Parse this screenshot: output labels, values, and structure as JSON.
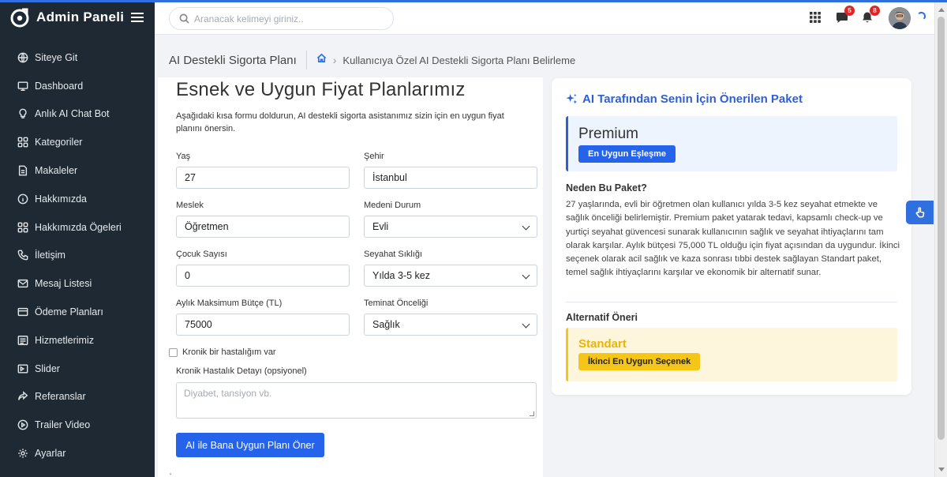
{
  "brand": {
    "title": "Admin Paneli",
    "icon": "logo-icon"
  },
  "sidebar": {
    "items": [
      {
        "label": "Siteye Git",
        "icon": "globe-icon"
      },
      {
        "label": "Dashboard",
        "icon": "monitor-icon"
      },
      {
        "label": "Anlık AI Chat Bot",
        "icon": "lightbulb-icon"
      },
      {
        "label": "Kategoriler",
        "icon": "grid-icon"
      },
      {
        "label": "Makaleler",
        "icon": "document-icon"
      },
      {
        "label": "Hakkımızda",
        "icon": "info-icon"
      },
      {
        "label": "Hakkımızda Ögeleri",
        "icon": "grid-icon"
      },
      {
        "label": "İletişim",
        "icon": "phone-icon"
      },
      {
        "label": "Mesaj Listesi",
        "icon": "mail-icon"
      },
      {
        "label": "Ödeme Planları",
        "icon": "credit-card-icon"
      },
      {
        "label": "Hizmetlerimiz",
        "icon": "list-icon"
      },
      {
        "label": "Slider",
        "icon": "slides-icon"
      },
      {
        "label": "Referanslar",
        "icon": "share-icon"
      },
      {
        "label": "Trailer Video",
        "icon": "play-icon"
      },
      {
        "label": "Ayarlar",
        "icon": "settings-icon"
      }
    ]
  },
  "header": {
    "search_placeholder": "Aranacak kelimeyi giriniz..",
    "messages_badge": "5",
    "notifications_badge": "8"
  },
  "page": {
    "title": "AI Destekli Sigorta Planı",
    "breadcrumb_current": "Kullanıcıya Özel AI Destekli Sigorta Planı Belirleme"
  },
  "form": {
    "heading": "Esnek ve Uygun Fiyat Planlarımız",
    "intro": "Aşağıdaki kısa formu doldurun, AI destekli sigorta asistanımız sizin için en uygun fiyat planını önersin.",
    "age_label": "Yaş",
    "age_value": "27",
    "city_label": "Şehir",
    "city_value": "İstanbul",
    "job_label": "Meslek",
    "job_value": "Öğretmen",
    "marital_label": "Medeni Durum",
    "marital_value": "Evli",
    "children_label": "Çocuk Sayısı",
    "children_value": "0",
    "travel_label": "Seyahat Sıklığı",
    "travel_value": "Yılda 3-5 kez",
    "budget_label": "Aylık Maksimum Bütçe (TL)",
    "budget_value": "75000",
    "coverage_label": "Teminat Önceliği",
    "coverage_value": "Sağlık",
    "chronic_checkbox_label": "Kronik bir hastalığım var",
    "chronic_detail_label": "Kronik Hastalık Detayı (opsiyonel)",
    "chronic_detail_placeholder": "Diyabet, tansiyon vb.",
    "submit_label": "AI ile Bana Uygun Planı Öner"
  },
  "recommendation": {
    "title": "AI Tarafından Senin İçin Önerilen Paket",
    "package_name": "Premium",
    "package_badge": "En Uygun Eşleşme",
    "why_title": "Neden Bu Paket?",
    "why_text": "27 yaşlarında, evli bir öğretmen olan kullanıcı yılda 3-5 kez seyahat etmekte ve sağlık önceliği belirlemiştir. Premium paket yatarak tedavi, kapsamlı check-up ve yurtiçi seyahat güvencesi sunarak kullanıcının sağlık ve seyahat ihtiyaçlarını tam olarak karşılar. Aylık bütçesi 75,000 TL olduğu için fiyat açısından da uygundur. İkinci seçenek olarak acil sağlık ve kaza sonrası tıbbi destek sağlayan Standart paket, temel sağlık ihtiyaçlarını karşılar ve ekonomik bir alternatif sunar.",
    "alt_title": "Alternatif Öneri",
    "alt_name": "Standart",
    "alt_badge": "İkinci En Uygun Seçenek"
  },
  "colors": {
    "primary": "#2563eb",
    "sidebar_bg": "#1f2933",
    "alt_accent": "#f5c518",
    "badge_red": "#e02424"
  }
}
